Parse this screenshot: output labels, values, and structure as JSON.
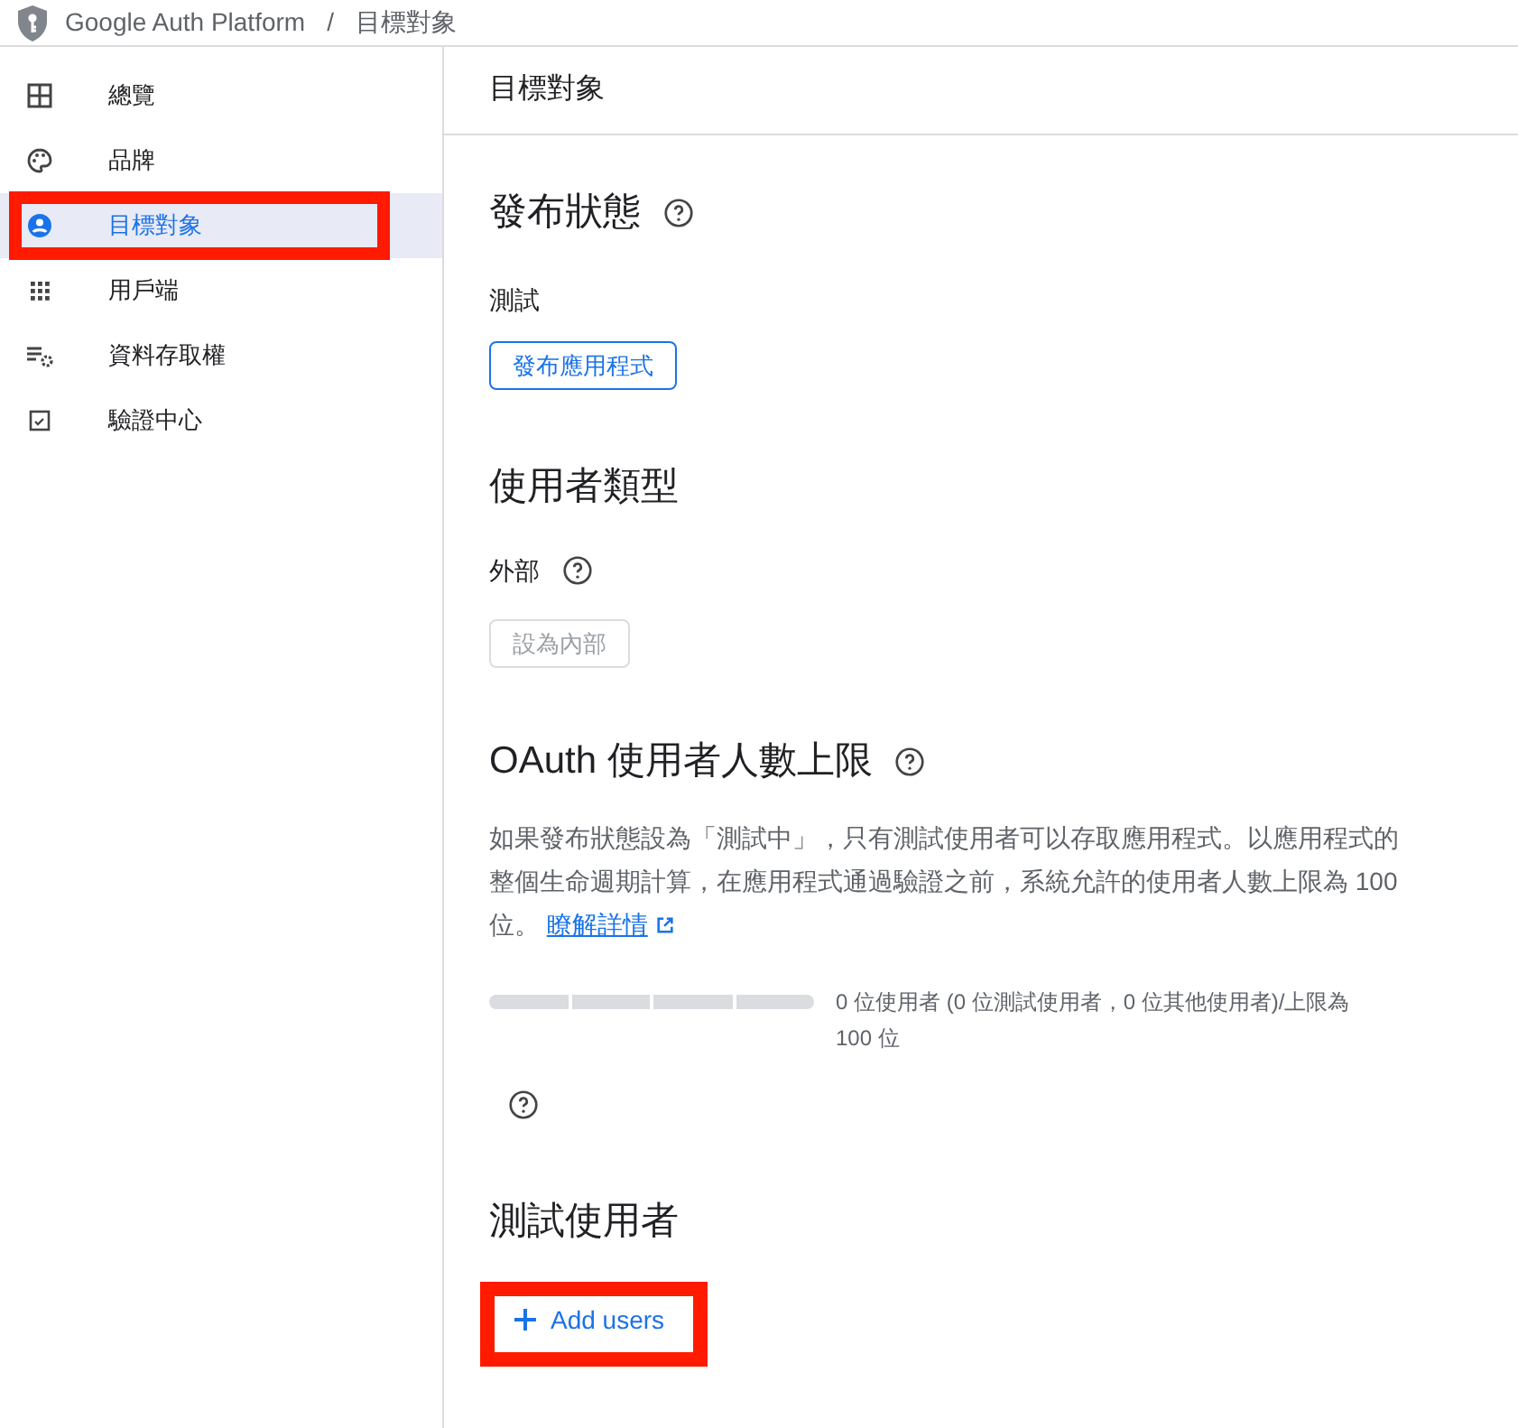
{
  "breadcrumb": {
    "product": "Google Auth Platform",
    "separator": "/",
    "page": "目標對象"
  },
  "sidebar": {
    "items": [
      {
        "label": "總覽",
        "selected": false,
        "highlighted": false
      },
      {
        "label": "品牌",
        "selected": false,
        "highlighted": false
      },
      {
        "label": "目標對象",
        "selected": true,
        "highlighted": true
      },
      {
        "label": "用戶端",
        "selected": false,
        "highlighted": false
      },
      {
        "label": "資料存取權",
        "selected": false,
        "highlighted": false
      },
      {
        "label": "驗證中心",
        "selected": false,
        "highlighted": false
      }
    ]
  },
  "page_title": "目標對象",
  "publishing_status": {
    "heading": "發布狀態",
    "status": "測試",
    "button": {
      "label": "發布應用程式",
      "disabled": false
    }
  },
  "user_type": {
    "heading": "使用者類型",
    "value": "外部",
    "button": {
      "label": "設為內部",
      "disabled": true
    }
  },
  "oauth_cap": {
    "heading": "OAuth 使用者人數上限",
    "description": "如果發布狀態設為「測試中」，只有測試使用者可以存取應用程式。以應用程式的整個生命週期計算，在應用程式通過驗證之前，系統允許的使用者人數上限為 100 位。",
    "link": "瞭解詳情",
    "meter": {
      "level": 0
    },
    "reading": "0 位使用者 (0 位測試使用者，0 位其他使用者)/上限為 100 位"
  },
  "test_users": {
    "heading": "測試使用者",
    "button": {
      "label": "Add users",
      "highlighted": true
    }
  }
}
